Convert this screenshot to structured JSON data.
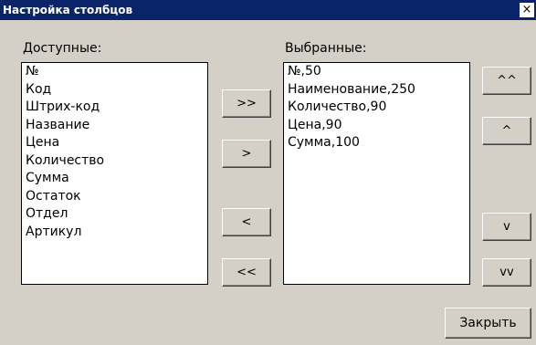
{
  "window": {
    "title": "Настройка столбцов",
    "close_label": "×"
  },
  "available": {
    "label": "Доступные:",
    "items": [
      "№",
      "Код",
      "Штрих-код",
      "Название",
      "Цена",
      "Количество",
      "Сумма",
      "Остаток",
      "Отдел",
      "Артикул"
    ]
  },
  "selected": {
    "label": "Выбранные:",
    "items": [
      "№,50",
      "Наименование,250",
      "Количество,90",
      "Цена,90",
      "Сумма,100"
    ]
  },
  "buttons": {
    "add_all": ">>",
    "add": ">",
    "remove": "<",
    "remove_all": "<<",
    "move_top": "^^",
    "move_up": "^",
    "move_down": "v",
    "move_bottom": "vv",
    "close": "Закрыть"
  }
}
